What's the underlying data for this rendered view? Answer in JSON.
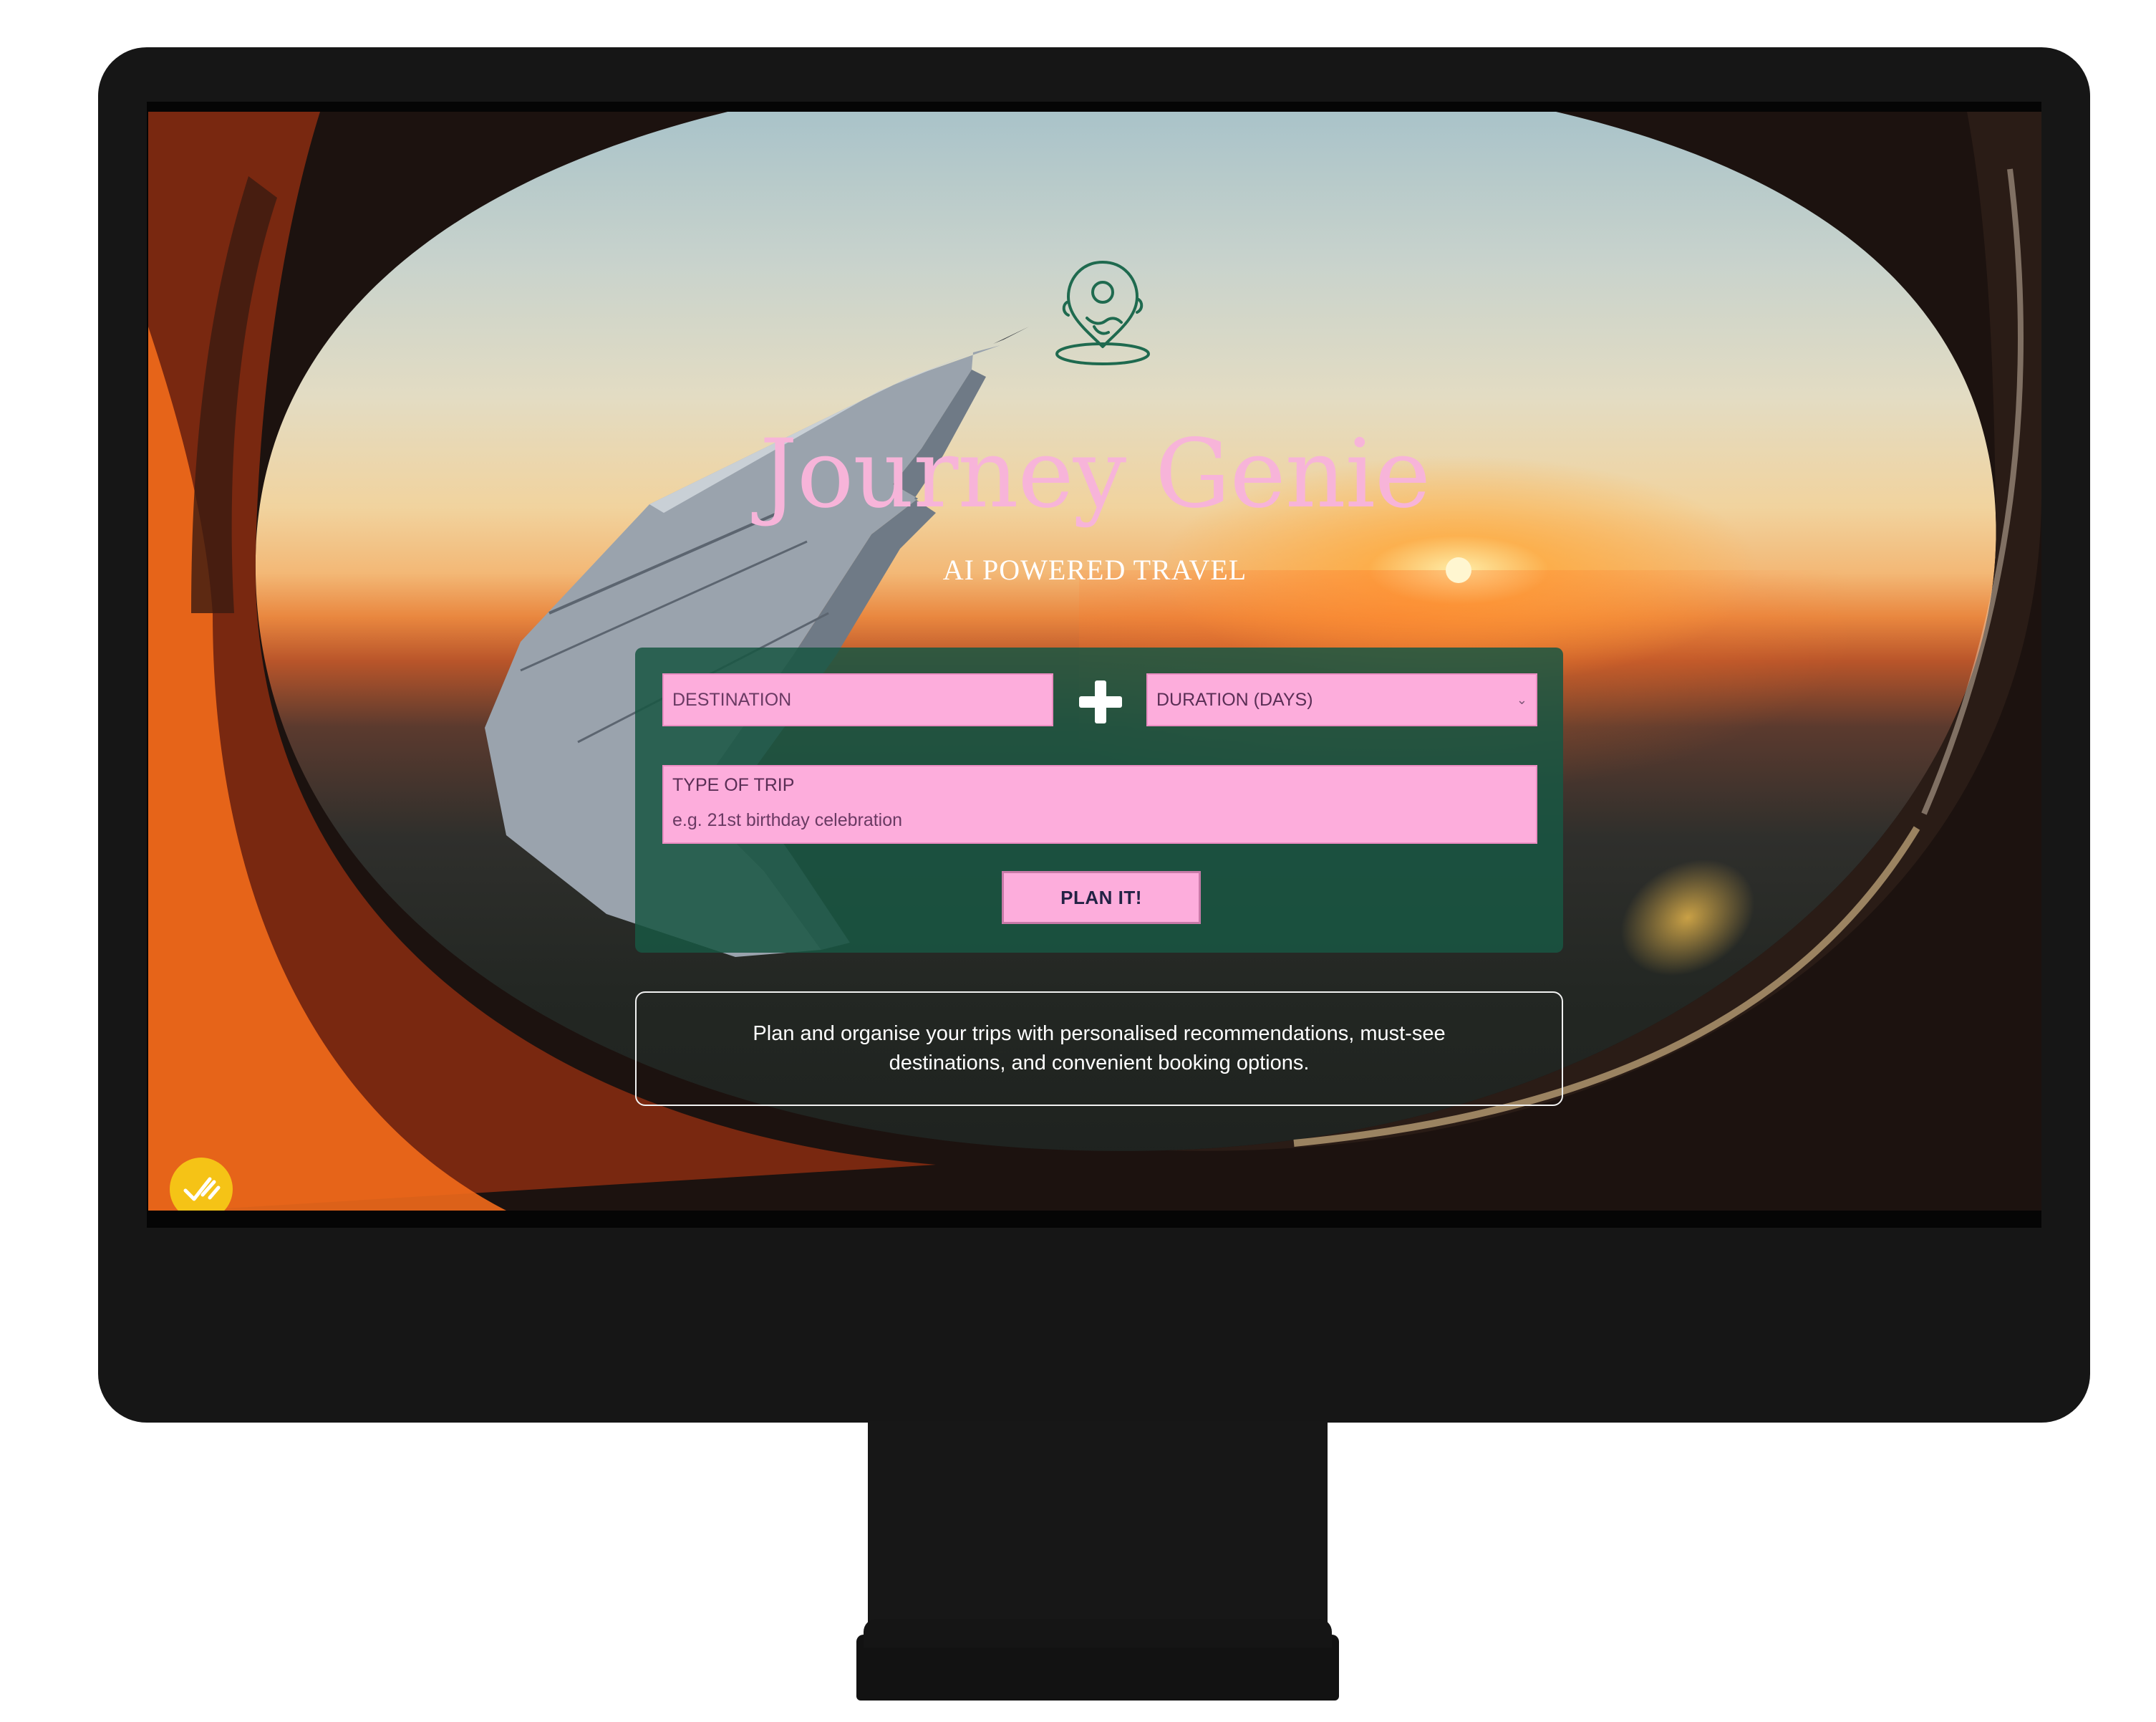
{
  "app": {
    "brand_title": "Journey Genie",
    "brand_subtitle": "AI POWERED TRAVEL"
  },
  "form": {
    "destination_placeholder": "DESTINATION",
    "duration_label": "DURATION (DAYS)",
    "duration_arrow_icon": "chevron-down-icon",
    "plus_icon": "plus-icon",
    "trip_type_label": "TYPE OF TRIP",
    "trip_type_placeholder": "e.g. 21st birthday celebration",
    "submit_label": "PLAN IT!"
  },
  "info": {
    "description": "Plan and organise your trips with personalised recommendations, must-see destinations, and convenient booking options."
  },
  "icons": {
    "logo": "map-pin-genie-icon",
    "badge": "checkmark-badge-icon"
  },
  "colors": {
    "accent_pink": "#fdaddc",
    "title_pink": "#f7b4d9",
    "card_green": "#185642",
    "logo_green": "#1f6a4f",
    "badge_yellow": "#f5c316"
  }
}
